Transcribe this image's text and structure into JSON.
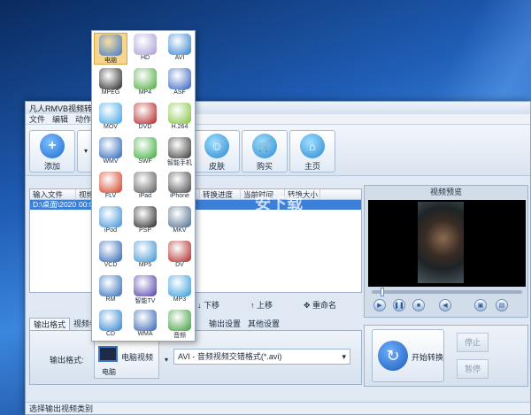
{
  "window": {
    "title": "凡人RMVB视频转换"
  },
  "menu": [
    "文件",
    "编辑",
    "动作",
    "帮"
  ],
  "toolbar": {
    "add_label": "添加",
    "skin_label": "皮肤",
    "buy_label": "购买",
    "home_label": "主页"
  },
  "file_list": {
    "columns": [
      "输入文件",
      "视频",
      "转换进度",
      "当前时间...",
      "转换大小"
    ],
    "row": {
      "file": "D:\\桌面\\2020...",
      "time": "00:0"
    }
  },
  "list_buttons": {
    "down_label": "下移",
    "up_label": "上移",
    "rename_label": "重命名"
  },
  "preview": {
    "title": "视频预览"
  },
  "tabs": [
    "输出格式",
    "视频参",
    "输出设置",
    "其他设置"
  ],
  "format": {
    "label": "输出格式:",
    "category": "电脑视频",
    "category_sub": "电脑",
    "value": "AVI - 音频视频交错格式(*.avi)"
  },
  "convert": {
    "start_label": "开始转换",
    "stop_label": "停止",
    "pause_label": "暂停"
  },
  "status": "选择输出视频类别",
  "watermark": {
    "line1": "安下载",
    "line2": "anxz.com"
  },
  "popup_items": [
    {
      "label": "电脑",
      "color": "#3d78c8",
      "icon": "computer-icon",
      "selected": true
    },
    {
      "label": "HD",
      "color": "#a79ad6",
      "icon": "hd-reel-icon"
    },
    {
      "label": "AVI",
      "color": "#2f7fd0",
      "icon": "avi-play-icon"
    },
    {
      "label": "MPEG",
      "color": "#222222",
      "icon": "film-reel-icon"
    },
    {
      "label": "MP4",
      "color": "#4aa83b",
      "icon": "mp4-film-icon"
    },
    {
      "label": "ASF",
      "color": "#3060c0",
      "icon": "asf-play-icon"
    },
    {
      "label": "MOV",
      "color": "#3aa0e6",
      "icon": "quicktime-icon"
    },
    {
      "label": "DVD",
      "color": "#b21d1d",
      "icon": "dvd-disc-icon"
    },
    {
      "label": "H.264",
      "color": "#7fc23a",
      "icon": "cube-icon"
    },
    {
      "label": "WMV",
      "color": "#2460b8",
      "icon": "wmv-icon"
    },
    {
      "label": "SWF",
      "color": "#3aaa36",
      "icon": "swf-icon"
    },
    {
      "label": "智能手机",
      "color": "#333333",
      "icon": "smartphone-icon"
    },
    {
      "label": "FLV",
      "color": "#d23a1d",
      "icon": "flash-icon"
    },
    {
      "label": "iPad",
      "color": "#555555",
      "icon": "ipad-icon"
    },
    {
      "label": "iPhone",
      "color": "#444444",
      "icon": "iphone-icon"
    },
    {
      "label": "iPod",
      "color": "#3a8ed8",
      "icon": "ipod-icon"
    },
    {
      "label": "PSP",
      "color": "#222222",
      "icon": "psp-icon"
    },
    {
      "label": "MKV",
      "color": "#4a6a8a",
      "icon": "mkv-icon"
    },
    {
      "label": "VCD",
      "color": "#2a60b0",
      "icon": "vcd-disc-icon"
    },
    {
      "label": "MP5",
      "color": "#3a90d0",
      "icon": "mp5-player-icon"
    },
    {
      "label": "DV",
      "color": "#b02020",
      "icon": "camcorder-icon"
    },
    {
      "label": "RM",
      "color": "#2a6ab8",
      "icon": "realmedia-icon"
    },
    {
      "label": "智能TV",
      "color": "#4a3aa8",
      "icon": "smart-tv-icon"
    },
    {
      "label": "MP3",
      "color": "#2f9ad8",
      "icon": "mp3-icon"
    },
    {
      "label": "CD",
      "color": "#2a80d0",
      "icon": "cd-disc-icon"
    },
    {
      "label": "WMA",
      "color": "#3060b0",
      "icon": "wma-icon"
    },
    {
      "label": "音频",
      "color": "#3a9a3a",
      "icon": "audio-icon"
    }
  ]
}
